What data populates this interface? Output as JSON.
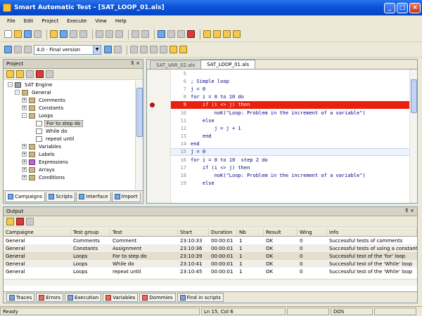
{
  "window": {
    "title": "Smart Automatic Test - [SAT_LOOP_01.als]"
  },
  "menu": [
    "File",
    "Edit",
    "Project",
    "Execute",
    "View",
    "Help"
  ],
  "toolbar": {
    "version_value": "4.0 - Final version"
  },
  "project": {
    "title": "Project",
    "tree": [
      {
        "level": 0,
        "expander": "-",
        "icon": "pc",
        "label": "SAT Engine"
      },
      {
        "level": 1,
        "expander": "-",
        "icon": "folder",
        "label": "General"
      },
      {
        "level": 2,
        "expander": "+",
        "icon": "folder",
        "label": "Comments"
      },
      {
        "level": 2,
        "expander": "+",
        "icon": "folder",
        "label": "Constants"
      },
      {
        "level": 2,
        "expander": "-",
        "icon": "folder",
        "label": "Loops"
      },
      {
        "level": 3,
        "expander": "",
        "icon": "doc",
        "label": "For to step do",
        "selected": true
      },
      {
        "level": 3,
        "expander": "",
        "icon": "doc",
        "label": "While do"
      },
      {
        "level": 3,
        "expander": "",
        "icon": "doc",
        "label": "repeat until"
      },
      {
        "level": 2,
        "expander": "+",
        "icon": "folder",
        "label": "Variables"
      },
      {
        "level": 2,
        "expander": "+",
        "icon": "folder",
        "label": "Labels"
      },
      {
        "level": 2,
        "expander": "+",
        "icon": "expr",
        "label": "Expressions"
      },
      {
        "level": 2,
        "expander": "+",
        "icon": "folder",
        "label": "Arrays"
      },
      {
        "level": 2,
        "expander": "+",
        "icon": "folder",
        "label": "Conditions"
      }
    ],
    "tabs": [
      "Campaigns",
      "Scripts",
      "Interface",
      "Import"
    ]
  },
  "editor": {
    "tabs": [
      "SAT_VAR_02.als",
      "SAT_LOOP_01.als"
    ],
    "active_tab": "SAT_LOOP_01.als",
    "lines": [
      {
        "num": "5",
        "code": ""
      },
      {
        "num": "6",
        "code": "; Simple loop"
      },
      {
        "num": "7",
        "code": "j = 0"
      },
      {
        "num": "8",
        "code": "for i = 0 to 10 do"
      },
      {
        "num": "9",
        "code": "    if (i <> j) then",
        "breakpoint": true
      },
      {
        "num": "10",
        "code": "        noK(\"Loop: Problem in the increment of a variable\")"
      },
      {
        "num": "11",
        "code": "    else"
      },
      {
        "num": "12",
        "code": "        j = j + 1"
      },
      {
        "num": "13",
        "code": "    end"
      },
      {
        "num": "14",
        "code": "end"
      },
      {
        "num": "15",
        "code": "j = 0",
        "current": true
      },
      {
        "num": "16",
        "code": "for i = 0 to 10  step 2 do"
      },
      {
        "num": "17",
        "code": "    if (i <> j) then"
      },
      {
        "num": "18",
        "code": "        noK(\"Loop: Problem in the increment of a variable\")"
      },
      {
        "num": "19",
        "code": "    else"
      }
    ]
  },
  "output": {
    "title": "Output",
    "columns": [
      "Campaigne",
      "Test group",
      "Test",
      "Start",
      "Duration",
      "Nb",
      "Result",
      "Wing",
      "Info"
    ],
    "rows": [
      [
        "General",
        "Comments",
        "Comment",
        "23:10:33",
        "00:00:01",
        "1",
        "OK",
        "0",
        "Successful tests of comments"
      ],
      [
        "General",
        "Constants",
        "Assignment",
        "23:10:36",
        "00:00:01",
        "1",
        "OK",
        "0",
        "Successful tests of using a constant"
      ],
      [
        "General",
        "Loops",
        "For to step do",
        "23:10:39",
        "00:00:01",
        "1",
        "OK",
        "0",
        "Successful test of the 'for' loop"
      ],
      [
        "General",
        "Loops",
        "While do",
        "23:10:41",
        "00:00:01",
        "1",
        "OK",
        "0",
        "Successful test of the 'While' loop"
      ],
      [
        "General",
        "Loops",
        "repeat until",
        "23:10:45",
        "00:00:01",
        "1",
        "OK",
        "0",
        "Successful test of the 'While' loop"
      ]
    ],
    "tabs": [
      "Traces",
      "Errors",
      "Execution",
      "Variables",
      "Dommies",
      "Find in scripts"
    ]
  },
  "status": {
    "ready": "Ready",
    "position": "Ln 15, Col 6",
    "mode": "DOS"
  }
}
